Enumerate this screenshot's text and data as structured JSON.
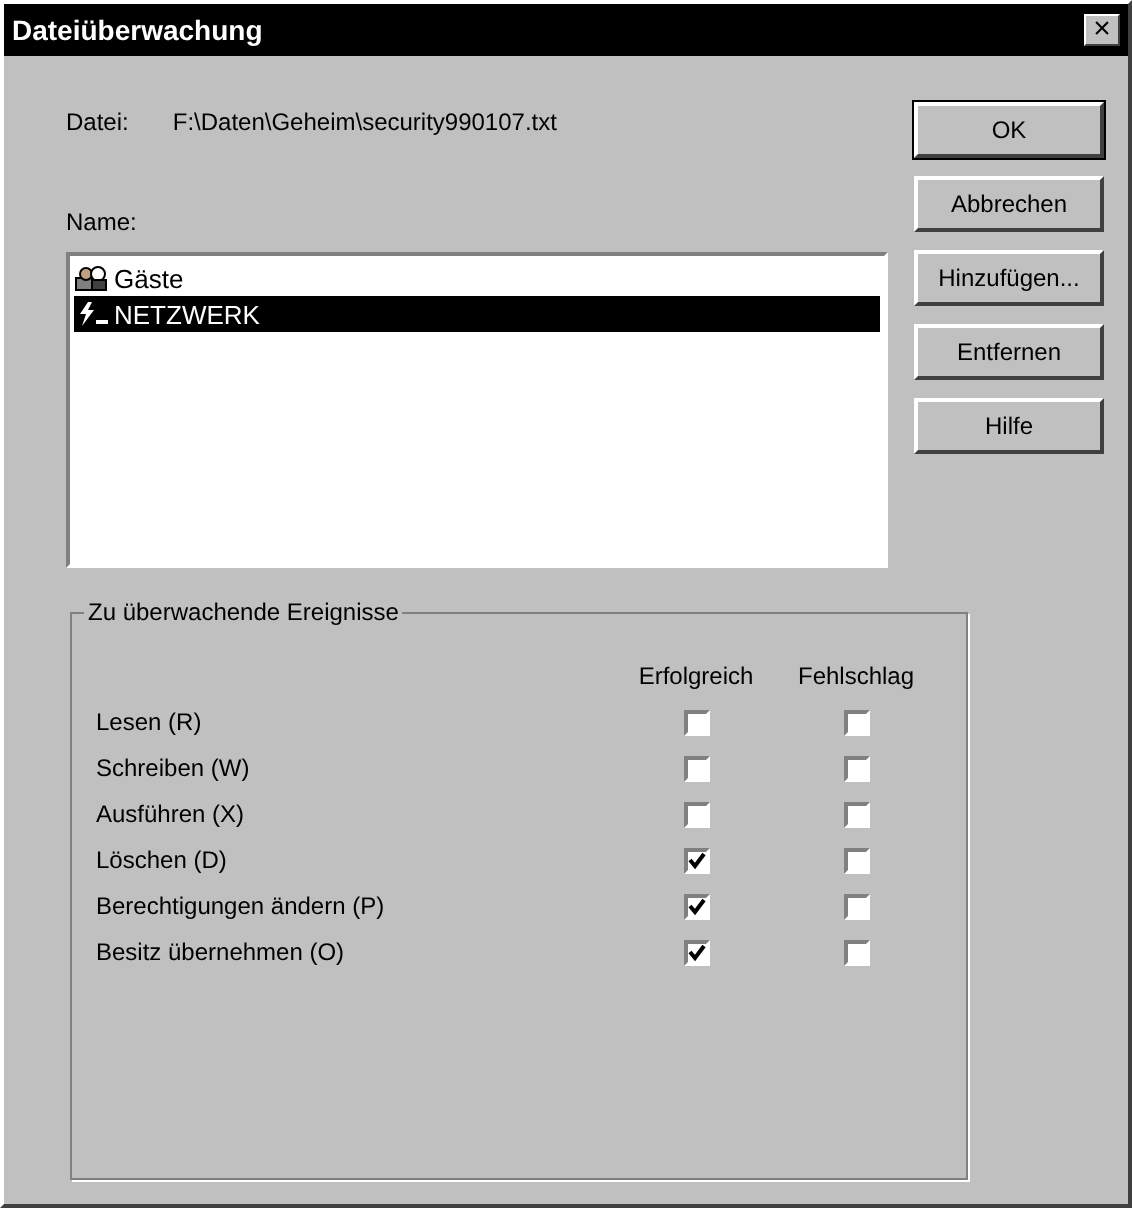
{
  "window": {
    "title": "Dateiüberwachung",
    "close": "×"
  },
  "file": {
    "label": "Datei:",
    "value": "F:\\Daten\\Geheim\\security990107.txt"
  },
  "buttons": [
    "OK",
    "Abbrechen",
    "Hinzufügen...",
    "Entfernen",
    "Hilfe"
  ],
  "names": {
    "label": "Name:",
    "items": [
      {
        "text": "Gäste",
        "kind": "group",
        "selected": false
      },
      {
        "text": "NETZWERK",
        "kind": "special",
        "selected": true
      }
    ]
  },
  "events": {
    "title": "Zu überwachende Ereignisse",
    "columns": [
      "Erfolgreich",
      "Fehlschlag"
    ],
    "rows": [
      {
        "label": "Lesen (R)",
        "success": false,
        "failure": false
      },
      {
        "label": "Schreiben (W)",
        "success": false,
        "failure": false
      },
      {
        "label": "Ausführen (X)",
        "success": false,
        "failure": false
      },
      {
        "label": "Löschen (D)",
        "success": true,
        "failure": false
      },
      {
        "label": "Berechtigungen ändern (P)",
        "success": true,
        "failure": false
      },
      {
        "label": "Besitz übernehmen (O)",
        "success": true,
        "failure": false
      }
    ]
  }
}
